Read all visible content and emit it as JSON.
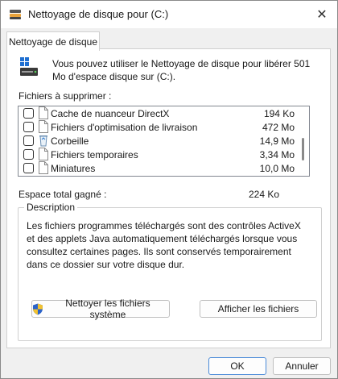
{
  "window": {
    "title": "Nettoyage de disque pour  (C:)",
    "close_glyph": "✕"
  },
  "tabs": [
    {
      "label": "Nettoyage de disque",
      "active": true
    }
  ],
  "intro": {
    "text": "Vous pouvez utiliser le Nettoyage de disque pour libérer 501 Mo d'espace disque sur  (C:)."
  },
  "files": {
    "label": "Fichiers à supprimer :",
    "items": [
      {
        "name": "Cache de nuanceur DirectX",
        "size": "194 Ko",
        "checked": false,
        "icon": "file-icon"
      },
      {
        "name": "Fichiers d'optimisation de livraison",
        "size": "472 Mo",
        "checked": false,
        "icon": "file-icon"
      },
      {
        "name": "Corbeille",
        "size": "14,9 Mo",
        "checked": false,
        "icon": "recycle-bin-icon"
      },
      {
        "name": "Fichiers temporaires",
        "size": "3,34 Mo",
        "checked": false,
        "icon": "file-icon"
      },
      {
        "name": "Miniatures",
        "size": "10,0 Mo",
        "checked": false,
        "icon": "file-icon"
      }
    ]
  },
  "total": {
    "label": "Espace total gagné :",
    "value": "224 Ko"
  },
  "description": {
    "title": "Description",
    "text": "Les fichiers programmes téléchargés sont des contrôles ActiveX et des applets Java automatiquement téléchargés lorsque vous consultez certaines pages. Ils sont conservés temporairement dans ce dossier sur votre disque dur."
  },
  "buttons": {
    "clean_system": "Nettoyer les fichiers système",
    "show_files": "Afficher les fichiers",
    "ok": "OK",
    "cancel": "Annuler"
  },
  "colors": {
    "accent": "#4a8ad8",
    "window_bg": "#f0f0f0"
  }
}
